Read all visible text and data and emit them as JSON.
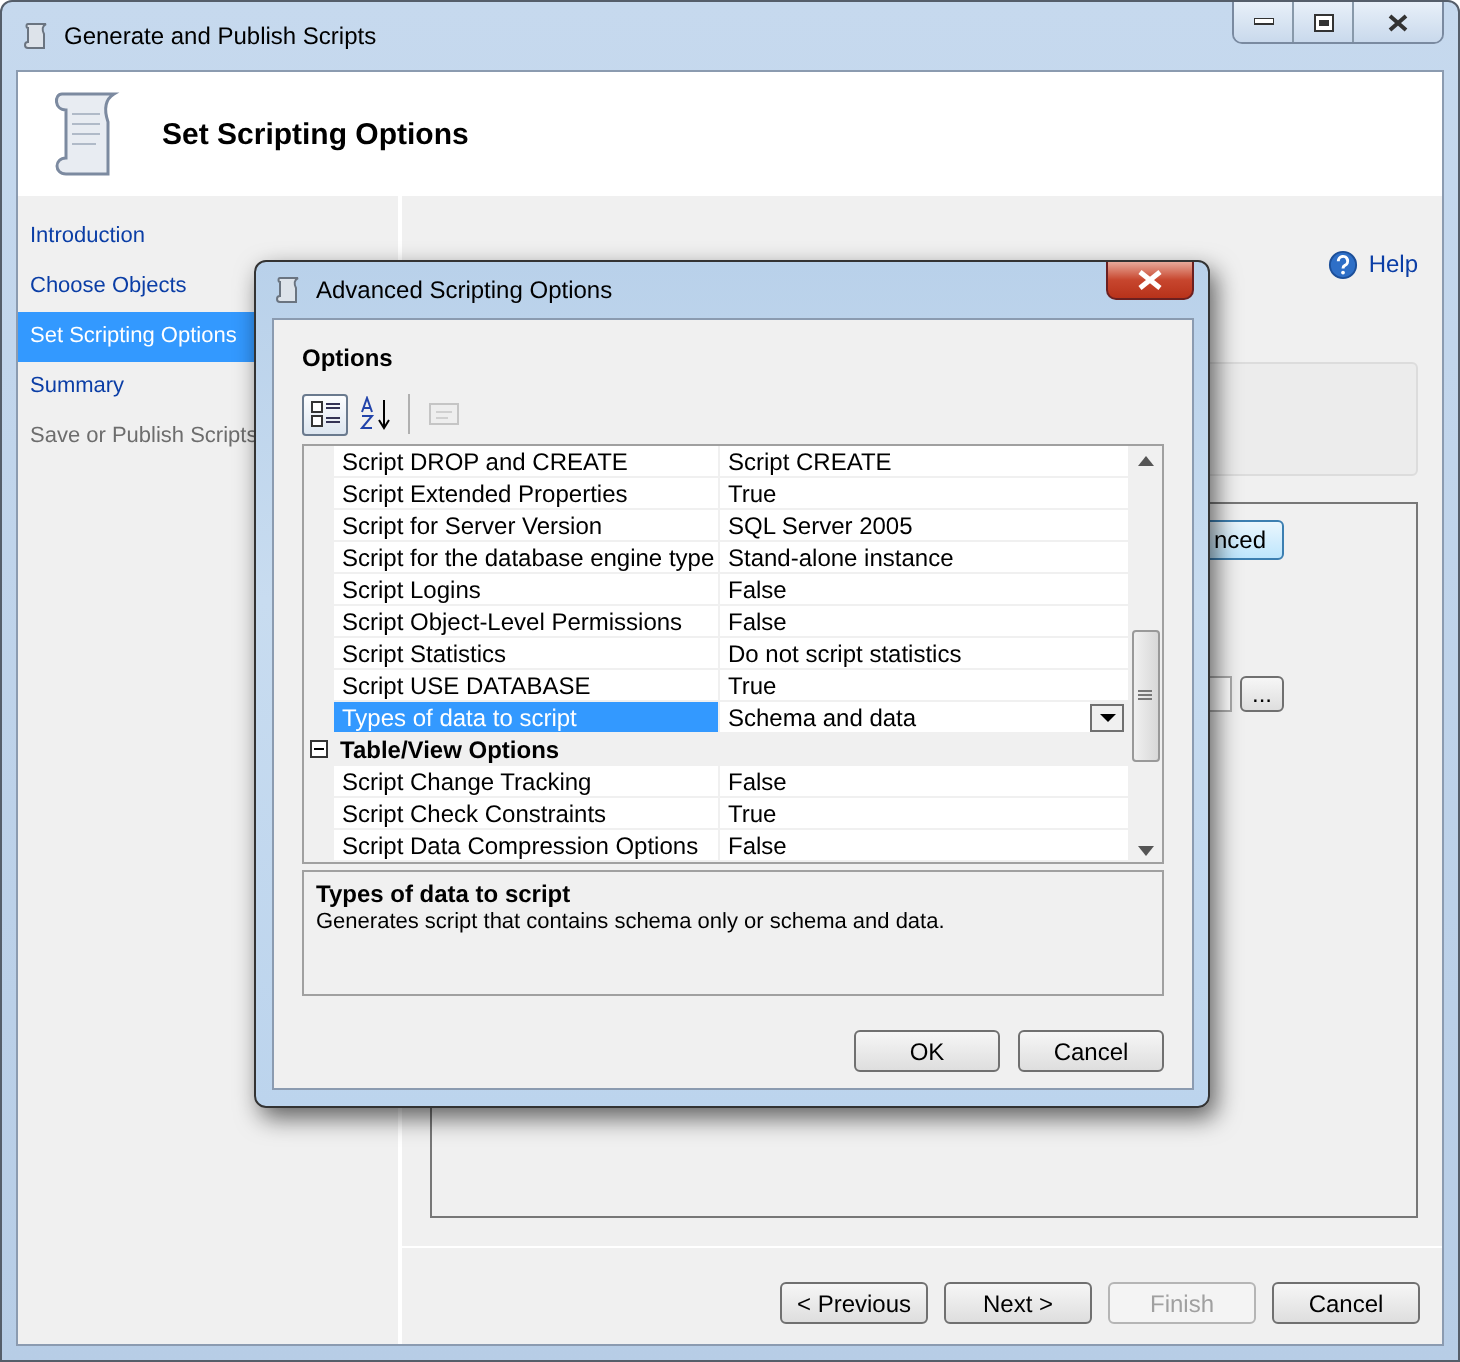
{
  "window": {
    "title": "Generate and Publish Scripts"
  },
  "header": {
    "title": "Set Scripting Options"
  },
  "nav": [
    {
      "label": "Introduction",
      "selected": false,
      "disabled": false
    },
    {
      "label": "Choose Objects",
      "selected": false,
      "disabled": false
    },
    {
      "label": "Set Scripting Options",
      "selected": true,
      "disabled": false
    },
    {
      "label": "Summary",
      "selected": false,
      "disabled": false
    },
    {
      "label": "Save or Publish Scripts",
      "selected": false,
      "disabled": true
    }
  ],
  "help": "Help",
  "background_controls": {
    "partial_button": "nced",
    "browse_button": "..."
  },
  "dialog": {
    "title": "Advanced Scripting Options",
    "section_label": "Options",
    "toolbar": [
      {
        "kind": "categorized",
        "selected": true,
        "disabled": false
      },
      {
        "kind": "alphabetical",
        "selected": false,
        "disabled": false
      },
      {
        "kind": "pages",
        "selected": false,
        "disabled": true
      }
    ],
    "rows": [
      {
        "kind": "property",
        "name": "Script DROP and CREATE",
        "value": "Script CREATE",
        "selected": false
      },
      {
        "kind": "property",
        "name": "Script Extended Properties",
        "value": "True",
        "selected": false
      },
      {
        "kind": "property",
        "name": "Script for Server Version",
        "value": "SQL Server 2005",
        "selected": false
      },
      {
        "kind": "property",
        "name": "Script for the database engine type",
        "value": "Stand-alone instance",
        "selected": false
      },
      {
        "kind": "property",
        "name": "Script Logins",
        "value": "False",
        "selected": false
      },
      {
        "kind": "property",
        "name": "Script Object-Level Permissions",
        "value": "False",
        "selected": false
      },
      {
        "kind": "property",
        "name": "Script Statistics",
        "value": "Do not script statistics",
        "selected": false
      },
      {
        "kind": "property",
        "name": "Script USE DATABASE",
        "value": "True",
        "selected": false
      },
      {
        "kind": "property",
        "name": "Types of data to script",
        "value": "Schema and data",
        "selected": true
      },
      {
        "kind": "category",
        "name": "Table/View Options",
        "expanded": true
      },
      {
        "kind": "property",
        "name": "Script Change Tracking",
        "value": "False",
        "selected": false
      },
      {
        "kind": "property",
        "name": "Script Check Constraints",
        "value": "True",
        "selected": false
      },
      {
        "kind": "property",
        "name": "Script Data Compression Options",
        "value": "False",
        "selected": false
      }
    ],
    "description": {
      "title": "Types of data to script",
      "text": "Generates script that contains schema only or schema and data."
    },
    "buttons": [
      "OK",
      "Cancel"
    ]
  },
  "footer_buttons": [
    {
      "label": "< Previous",
      "disabled": false
    },
    {
      "label": "Next >",
      "disabled": false
    },
    {
      "label": "Finish",
      "disabled": true
    },
    {
      "label": "Cancel",
      "disabled": false
    }
  ]
}
